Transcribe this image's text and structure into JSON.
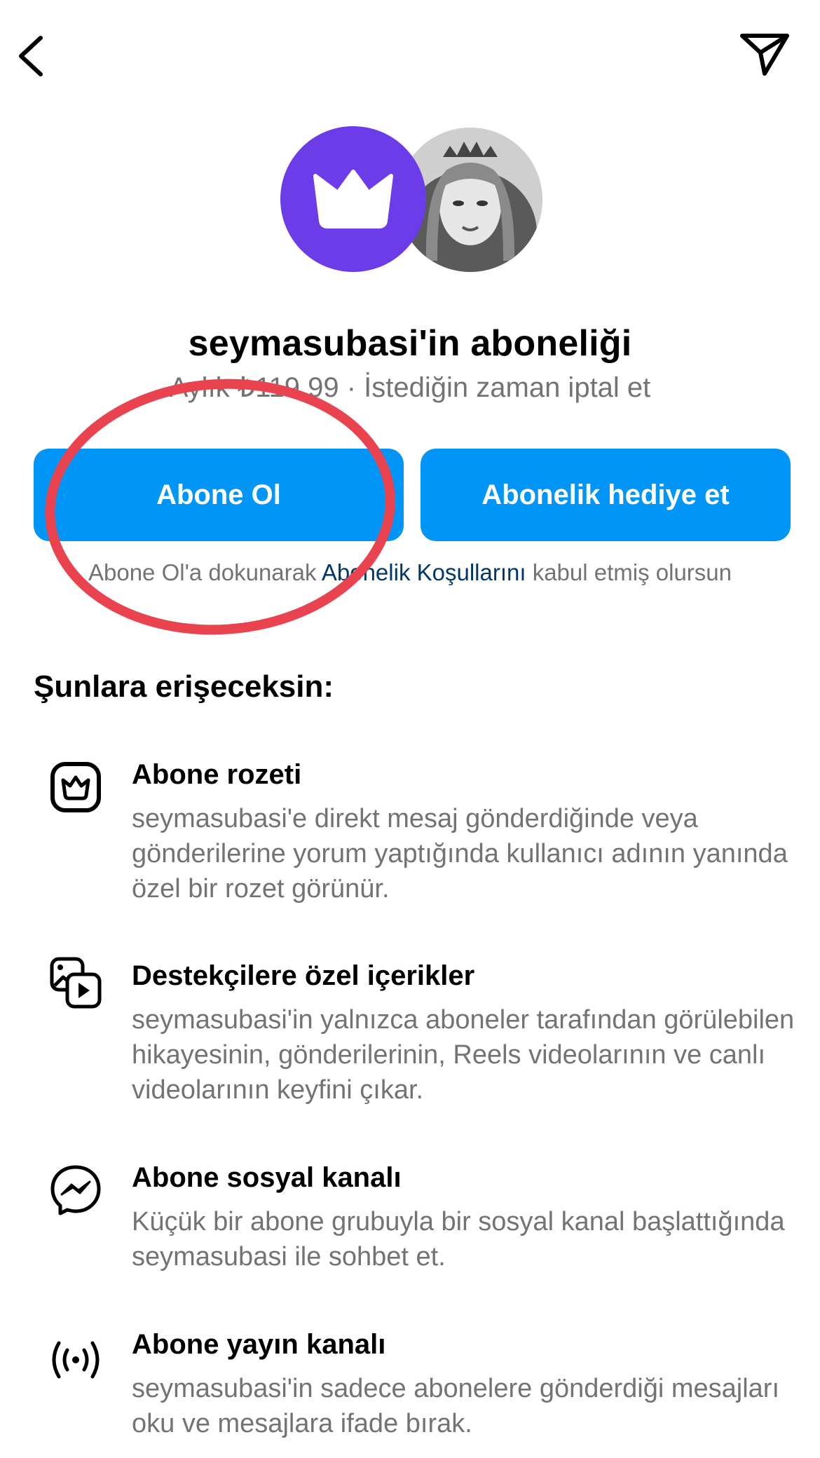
{
  "header": {
    "back_icon": "chevron-left-icon",
    "share_icon": "paper-plane-icon"
  },
  "profile": {
    "badge_icon": "crown-icon",
    "badge_color": "#6c3ce9"
  },
  "title": "seymasubasi'in aboneliği",
  "subtitle": "Aylık ₺119,99 · İstediğin zaman iptal et",
  "buttons": {
    "subscribe": "Abone Ol",
    "gift": "Abonelik hediye et",
    "color": "#0095f6"
  },
  "terms": {
    "prefix": "Abone Ol'a dokunarak ",
    "link": "Abonelik Koşullarını",
    "suffix": " kabul etmiş olursun"
  },
  "section_title": "Şunlara erişeceksin:",
  "features": [
    {
      "icon": "badge-crown-icon",
      "title": "Abone rozeti",
      "description": "seymasubasi'e direkt mesaj gönderdiğinde veya gönderilerine yorum yaptığında kullanıcı adının yanında özel bir rozet görünür."
    },
    {
      "icon": "media-play-icon",
      "title": "Destekçilere özel içerikler",
      "description": "seymasubasi'in yalnızca aboneler tarafından görülebilen hikayesinin, gönderilerinin, Reels videolarının ve canlı videolarının keyfini çıkar."
    },
    {
      "icon": "messenger-icon",
      "title": "Abone sosyal kanalı",
      "description": "Küçük bir abone grubuyla bir sosyal kanal başlattığında seymasubasi ile sohbet et."
    },
    {
      "icon": "broadcast-icon",
      "title": "Abone yayın kanalı",
      "description": "seymasubasi'in sadece abonelere gönderdiği mesajları oku ve mesajlara ifade bırak."
    }
  ],
  "annotation": {
    "color": "#e8434f"
  }
}
